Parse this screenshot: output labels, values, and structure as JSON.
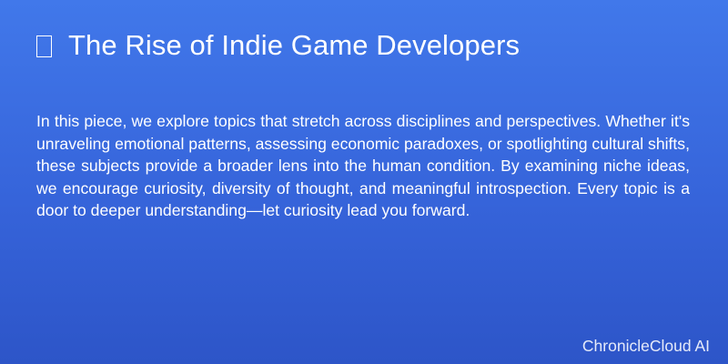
{
  "header": {
    "icon": "unsupported-glyph-box-icon",
    "title": "The Rise of Indie Game Developers"
  },
  "article": {
    "body": "In this piece, we explore topics that stretch across disciplines and perspectives. Whether it's unraveling emotional patterns, assessing economic paradoxes, or spotlighting cultural shifts, these subjects provide a broader lens into the human condition. By examining niche ideas, we encourage curiosity, diversity of thought, and meaningful introspection. Every topic is a door to deeper understanding—let curiosity lead you forward."
  },
  "footer": {
    "brand": "ChronicleCloud AI"
  },
  "colors": {
    "background_top": "#4178ea",
    "background_bottom": "#2d55c8",
    "text": "#ffffff"
  }
}
